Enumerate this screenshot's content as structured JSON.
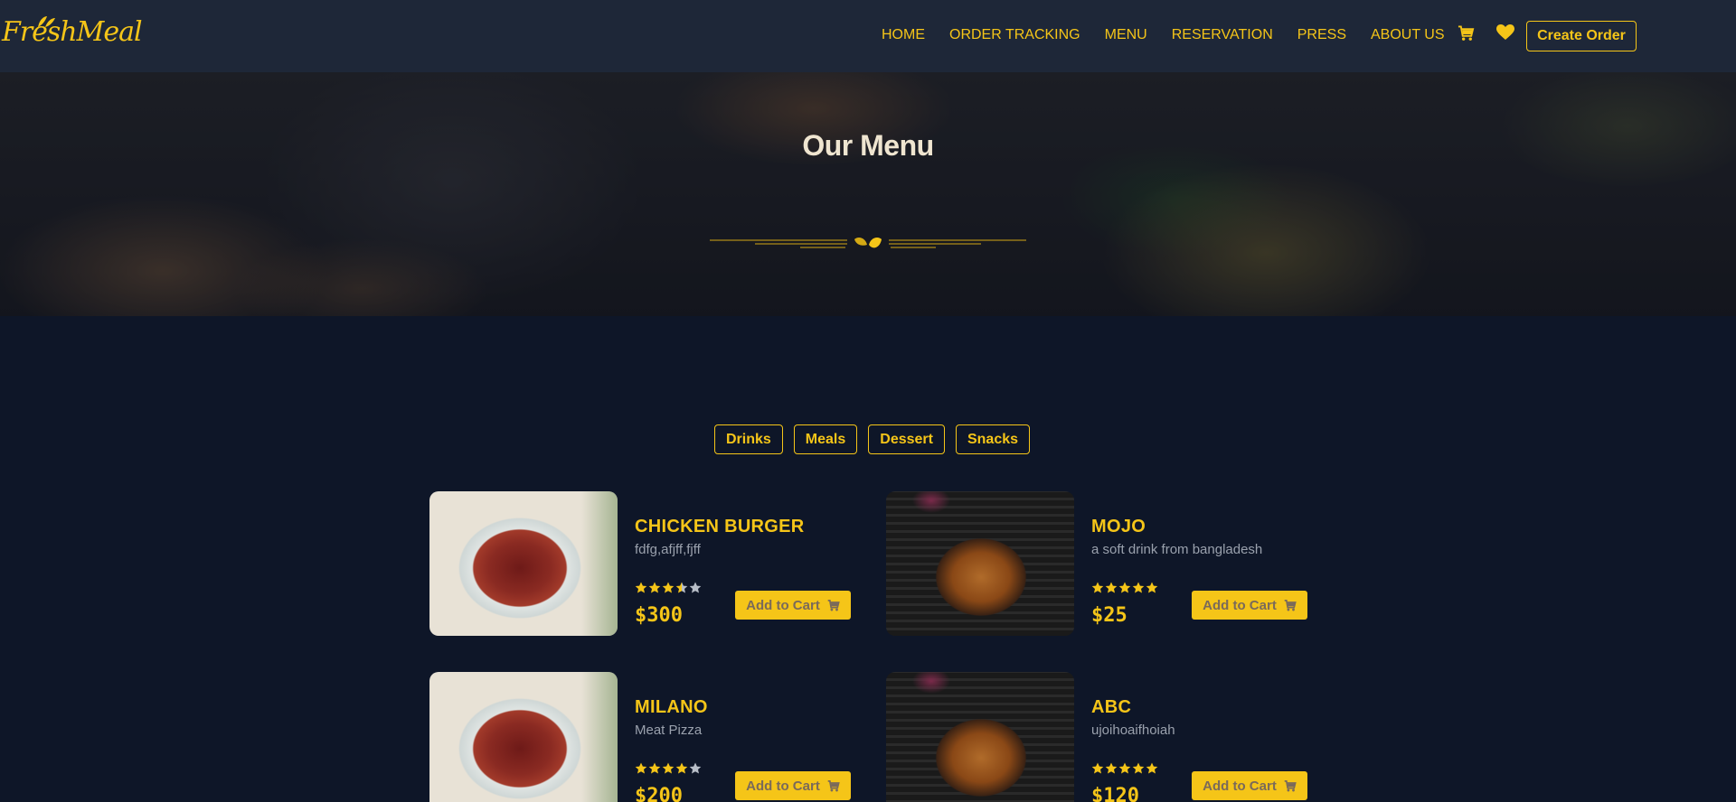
{
  "brand": {
    "logo_text": "FreshMeal"
  },
  "nav": {
    "items": [
      "HOME",
      "ORDER TRACKING",
      "MENU",
      "RESERVATION",
      "PRESS",
      "ABOUT US"
    ],
    "cart_icon": "cart-icon",
    "heart_icon": "heart-icon",
    "create_order": "Create Order"
  },
  "hero": {
    "title": "Our Menu"
  },
  "filters": [
    "Drinks",
    "Meals",
    "Dessert",
    "Snacks"
  ],
  "menu": [
    {
      "title": "CHICKEN BURGER",
      "desc": "fdfg,afjff,fjff",
      "rating": 3.5,
      "price": "$300",
      "button": "Add to Cart",
      "image": "bowl"
    },
    {
      "title": "MOJO",
      "desc": "a soft drink from bangladesh",
      "rating": 5,
      "price": "$25",
      "button": "Add to Cart",
      "image": "chicken"
    },
    {
      "title": "MILANO",
      "desc": "Meat Pizza",
      "rating": 4,
      "price": "$200",
      "button": "Add to Cart",
      "image": "bowl"
    },
    {
      "title": "ABC",
      "desc": "ujoihoaifhoiah",
      "rating": 5,
      "price": "$120",
      "button": "Add to Cart",
      "image": "chicken"
    }
  ],
  "colors": {
    "accent": "#f5c518",
    "background": "#0e1628",
    "header": "#1e2738"
  }
}
